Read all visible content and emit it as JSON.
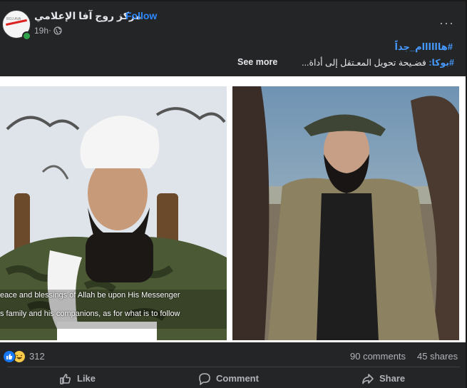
{
  "post": {
    "page_name": "مركز روج آفا الإعلامي",
    "separator": "·",
    "follow_label": "Follow",
    "time": "19h",
    "time_sep": "·",
    "more_label": "···",
    "avatar_logo_text": "ROJ AVA"
  },
  "caption": {
    "hashtag_line": "#هاااااام_جداً",
    "tag": "#بوكا:",
    "text": "فضـيحة تحويل المعـتقل إلى أداة...",
    "see_more": "See more"
  },
  "photos": [
    {
      "subtitle_line1": "eace and blessings of Allah be upon His Messenger",
      "subtitle_line2": "s family and his companions, as for what is to follow"
    },
    {}
  ],
  "stats": {
    "reaction_count": "312",
    "comments": "90 comments",
    "shares": "45 shares"
  },
  "actions": {
    "like": "Like",
    "comment": "Comment",
    "share": "Share"
  },
  "colors": {
    "background": "#242526",
    "link": "#2d88ff",
    "hashtag": "#4599ff",
    "like_blue": "#1877f2",
    "online": "#31a24c"
  }
}
